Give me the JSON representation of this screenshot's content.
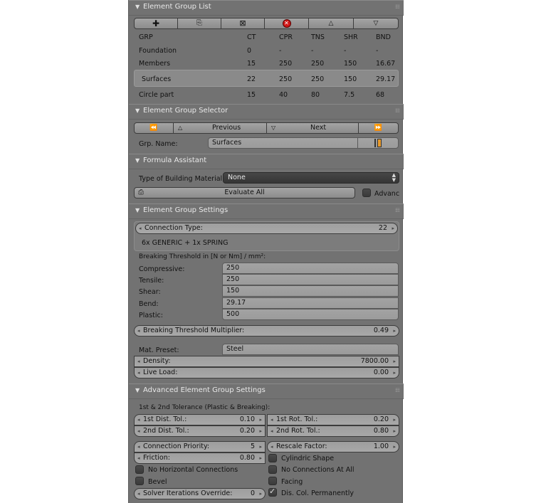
{
  "element_group_list": {
    "title": "Element Group List",
    "toolbar_icons": [
      "add-icon",
      "copy-icon",
      "remove-icon",
      "delete-all-icon",
      "move-up-icon",
      "move-down-icon"
    ],
    "columns": [
      "GRP",
      "CT",
      "CPR",
      "TNS",
      "SHR",
      "BND"
    ],
    "rows": [
      [
        "Foundation",
        "0",
        "-",
        "-",
        "-",
        "-"
      ],
      [
        "Members",
        "15",
        "250",
        "250",
        "150",
        "16.67"
      ],
      [
        "Surfaces",
        "22",
        "250",
        "250",
        "150",
        "29.17"
      ],
      [
        "Circle part",
        "15",
        "40",
        "80",
        "7.5",
        "68"
      ]
    ],
    "selected_row": 2
  },
  "element_group_selector": {
    "title": "Element Group Selector",
    "first_label": "",
    "previous_label": "Previous",
    "next_label": "Next",
    "grp_name_label": "Grp. Name:",
    "grp_name_value": "Surfaces"
  },
  "formula_assistant": {
    "title": "Formula Assistant",
    "material_label": "Type of Building Material:",
    "material_value": "None",
    "evaluate_label": "Evaluate All",
    "advanced_label": "Advanc"
  },
  "element_group_settings": {
    "title": "Element Group Settings",
    "connection_type_label": "Connection Type:",
    "connection_type_value": "22",
    "connection_desc": "6x GENERIC + 1x SPRING",
    "threshold_heading": "Breaking Threshold in [N or Nm] / mm²:",
    "thresholds": [
      {
        "label": "Compressive:",
        "value": "250"
      },
      {
        "label": "Tensile:",
        "value": "250"
      },
      {
        "label": "Shear:",
        "value": "150"
      },
      {
        "label": "Bend:",
        "value": "29.17"
      },
      {
        "label": "Plastic:",
        "value": "500"
      }
    ],
    "multiplier_label": "Breaking Threshold Multiplier:",
    "multiplier_value": "0.49",
    "mat_preset_label": "Mat. Preset:",
    "mat_preset_value": "Steel",
    "density_label": "Density:",
    "density_value": "7800.00",
    "live_load_label": "Live Load:",
    "live_load_value": "0.00"
  },
  "advanced_settings": {
    "title": "Advanced Element Group Settings",
    "tolerance_heading": "1st & 2nd Tolerance (Plastic & Breaking):",
    "dist_tol_1_label": "1st Dist. Tol.:",
    "dist_tol_1_value": "0.10",
    "rot_tol_1_label": "1st Rot. Tol.:",
    "rot_tol_1_value": "0.20",
    "dist_tol_2_label": "2nd Dist. Tol.:",
    "dist_tol_2_value": "0.20",
    "rot_tol_2_label": "2nd Rot. Tol.:",
    "rot_tol_2_value": "0.80",
    "priority_label": "Connection Priority:",
    "priority_value": "5",
    "rescale_label": "Rescale Factor:",
    "rescale_value": "1.00",
    "friction_label": "Friction:",
    "friction_value": "0.80",
    "cylindric_label": "Cylindric Shape",
    "no_horizontal_label": "No Horizontal Connections",
    "no_connections_label": "No Connections At All",
    "bevel_label": "Bevel",
    "facing_label": "Facing",
    "solver_label": "Solver Iterations Override:",
    "solver_value": "0",
    "dis_col_label": "Dis. Col. Permanently"
  },
  "colors": {
    "panel_bg": "#727272",
    "button_bg": "#999999",
    "dark_field": "#3f3f3f",
    "delete_icon": "#d01818",
    "slider_accent": "#e89a2c"
  }
}
